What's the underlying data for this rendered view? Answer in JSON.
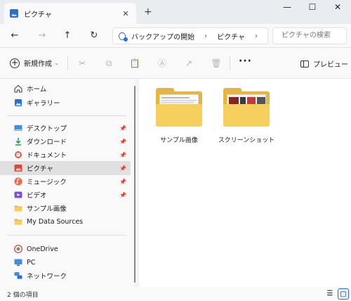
{
  "window": {
    "tab_title": "ピクチャ",
    "tab_close": "✕",
    "new_tab": "+",
    "minimize": "—",
    "maximize": "☐",
    "close": "✕"
  },
  "nav": {
    "back": "←",
    "forward": "→",
    "up": "↑",
    "refresh": "↻",
    "breadcrumb": [
      "バックアップの開始",
      "ピクチャ"
    ],
    "breadcrumb_sep": "›",
    "search_placeholder": "ピクチャの検索"
  },
  "toolbar": {
    "new_label": "新規作成",
    "new_plus": "+",
    "new_caret": "⌄",
    "cut": "✂",
    "copy": "⧉",
    "paste": "📋",
    "rename": "Ⓐ",
    "share": "↗",
    "delete": "🗑",
    "more": "···",
    "preview_label": "プレビュー"
  },
  "sidebar": {
    "top": [
      {
        "label": "ホーム",
        "icon": "home-icon"
      },
      {
        "label": "ギャラリー",
        "icon": "gallery-icon"
      }
    ],
    "pinned": [
      {
        "label": "デスクトップ",
        "icon": "desktop-icon",
        "pin": "📌"
      },
      {
        "label": "ダウンロード",
        "icon": "download-icon",
        "pin": "📌"
      },
      {
        "label": "ドキュメント",
        "icon": "documents-icon",
        "pin": "📌"
      },
      {
        "label": "ピクチャ",
        "icon": "pictures-icon",
        "pin": "📌"
      },
      {
        "label": "ミュージック",
        "icon": "music-icon",
        "pin": "📌"
      },
      {
        "label": "ビデオ",
        "icon": "video-icon",
        "pin": "📌"
      },
      {
        "label": "サンプル画像",
        "icon": "folder-icon"
      },
      {
        "label": "My Data Sources",
        "icon": "folder-icon"
      }
    ],
    "bottom": [
      {
        "label": "OneDrive",
        "icon": "onedrive-icon"
      },
      {
        "label": "PC",
        "icon": "pc-icon"
      },
      {
        "label": "ネットワーク",
        "icon": "network-icon"
      }
    ]
  },
  "content": {
    "items": [
      {
        "name": "サンプル画像",
        "type": "folder"
      },
      {
        "name": "スクリーンショット",
        "type": "folder"
      }
    ]
  },
  "status": {
    "item_count": "2 個の項目",
    "details_view": "☰",
    "tiles_view": "▢"
  },
  "colors": {
    "accent": "#2b6fd4",
    "folder_front": "#f7cf5e",
    "folder_back": "#e6b53e",
    "selected_bg": "#e0e0e0"
  }
}
